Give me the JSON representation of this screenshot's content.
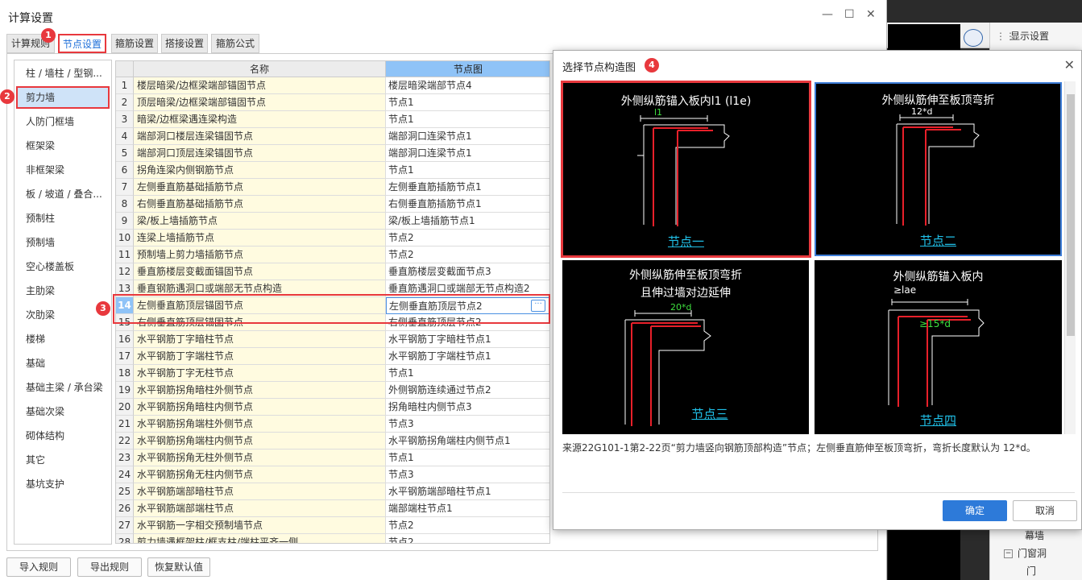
{
  "window": {
    "title": "计算设置",
    "min_icon": "—",
    "max_icon": "☐",
    "close_icon": "✕"
  },
  "tabs": [
    {
      "label": "计算规则"
    },
    {
      "label": "节点设置"
    },
    {
      "label": "箍筋设置"
    },
    {
      "label": "搭接设置"
    },
    {
      "label": "箍筋公式"
    }
  ],
  "categories": [
    "柱 / 墙柱 / 型钢...",
    "剪力墙",
    "人防门框墙",
    "框架梁",
    "非框架梁",
    "板 / 坡道 / 叠合...",
    "预制柱",
    "预制墙",
    "空心楼盖板",
    "主肋梁",
    "次肋梁",
    "楼梯",
    "基础",
    "基础主梁 / 承台梁",
    "基础次梁",
    "砌体结构",
    "其它",
    "基坑支护"
  ],
  "grid": {
    "col_name": "名称",
    "col_node": "节点图",
    "rows": [
      {
        "num": "1",
        "name": "楼层暗梁/边框梁端部锚固节点",
        "node": "楼层暗梁端部节点4"
      },
      {
        "num": "2",
        "name": "顶层暗梁/边框梁端部锚固节点",
        "node": "节点1"
      },
      {
        "num": "3",
        "name": "暗梁/边框梁遇连梁构造",
        "node": "节点1"
      },
      {
        "num": "4",
        "name": "端部洞口楼层连梁锚固节点",
        "node": "端部洞口连梁节点1"
      },
      {
        "num": "5",
        "name": "端部洞口顶层连梁锚固节点",
        "node": "端部洞口连梁节点1"
      },
      {
        "num": "6",
        "name": "拐角连梁内侧钢筋节点",
        "node": "节点1"
      },
      {
        "num": "7",
        "name": "左侧垂直筋基础插筋节点",
        "node": "左侧垂直筋插筋节点1"
      },
      {
        "num": "8",
        "name": "右侧垂直筋基础插筋节点",
        "node": "右侧垂直筋插筋节点1"
      },
      {
        "num": "9",
        "name": "梁/板上墙插筋节点",
        "node": "梁/板上墙插筋节点1"
      },
      {
        "num": "10",
        "name": "连梁上墙插筋节点",
        "node": "节点2"
      },
      {
        "num": "11",
        "name": "预制墙上剪力墙插筋节点",
        "node": "节点2"
      },
      {
        "num": "12",
        "name": "垂直筋楼层变截面锚固节点",
        "node": "垂直筋楼层变截面节点3"
      },
      {
        "num": "13",
        "name": "垂直钢筋遇洞口或端部无节点构造",
        "node": "垂直筋遇洞口或端部无节点构造2"
      },
      {
        "num": "14",
        "name": "左侧垂直筋顶层锚固节点",
        "node": "左侧垂直筋顶层节点2"
      },
      {
        "num": "15",
        "name": "右侧垂直筋顶层锚固节点",
        "node": "右侧垂直筋顶层节点2"
      },
      {
        "num": "16",
        "name": "水平钢筋丁字暗柱节点",
        "node": "水平钢筋丁字暗柱节点1"
      },
      {
        "num": "17",
        "name": "水平钢筋丁字端柱节点",
        "node": "水平钢筋丁字端柱节点1"
      },
      {
        "num": "18",
        "name": "水平钢筋丁字无柱节点",
        "node": "节点1"
      },
      {
        "num": "19",
        "name": "水平钢筋拐角暗柱外侧节点",
        "node": "外侧钢筋连续通过节点2"
      },
      {
        "num": "20",
        "name": "水平钢筋拐角暗柱内侧节点",
        "node": "拐角暗柱内侧节点3"
      },
      {
        "num": "21",
        "name": "水平钢筋拐角端柱外侧节点",
        "node": "节点3"
      },
      {
        "num": "22",
        "name": "水平钢筋拐角端柱内侧节点",
        "node": "水平钢筋拐角端柱内侧节点1"
      },
      {
        "num": "23",
        "name": "水平钢筋拐角无柱外侧节点",
        "node": "节点1"
      },
      {
        "num": "24",
        "name": "水平钢筋拐角无柱内侧节点",
        "node": "节点3"
      },
      {
        "num": "25",
        "name": "水平钢筋端部暗柱节点",
        "node": "水平钢筋端部暗柱节点1"
      },
      {
        "num": "26",
        "name": "水平钢筋端部端柱节点",
        "node": "端部端柱节点1"
      },
      {
        "num": "27",
        "name": "水平钢筋一字相交预制墙节点",
        "node": "节点2"
      },
      {
        "num": "28",
        "name": "剪力墙遇框架柱/框支柱/端柱平齐一侧",
        "node": "节点2"
      }
    ],
    "more_icon": "···"
  },
  "buttons": {
    "import": "导入规则",
    "export": "导出规则",
    "restore": "恢复默认值"
  },
  "badges": [
    "1",
    "2",
    "3",
    "4"
  ],
  "popup": {
    "title": "选择节点构造图",
    "close_icon": "✕",
    "options": [
      {
        "title": "外侧纵筋锚入板内l1 (l1e)",
        "dim": "l1",
        "label": "节点一"
      },
      {
        "title": "外侧纵筋伸至板顶弯折",
        "dim": "12*d",
        "label": "节点二"
      },
      {
        "title": "外侧纵筋伸至板顶弯折\n且伸过墙对边延伸",
        "dim": "20*d",
        "label": "节点三"
      },
      {
        "title": "外侧纵筋锚入板内",
        "dim": "≥lae",
        "dim2": "≥15*d",
        "label": "节点四"
      }
    ],
    "description": "来源22G101-1第2-22页“剪力墙竖向钢筋顶部构造”节点；左侧垂直筋伸至板顶弯折，弯折长度默认为 12*d。",
    "ok": "确定",
    "cancel": "取消"
  },
  "background_app": {
    "display_settings": "显示设置",
    "grip_icon": "⋮⋮",
    "tree_items": [
      "幕墙",
      "门窗洞",
      "门"
    ],
    "tree_toggle": "−"
  },
  "colors": {
    "accent": "#2d7ad9",
    "highlight_red": "#e8383d",
    "rebar_red": "#e8202a",
    "label_cyan": "#20c0e8"
  }
}
